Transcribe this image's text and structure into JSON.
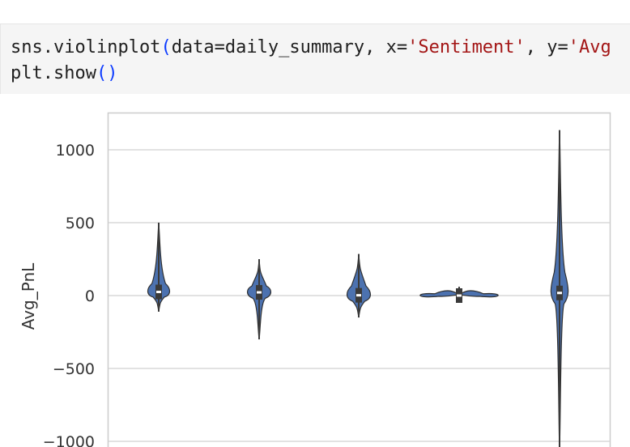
{
  "code_cell": {
    "line1": {
      "prefix": "sns.violinplot",
      "open_paren": "(",
      "args_a": "data=daily_summary, x=",
      "str_x": "'Sentiment'",
      "args_b": ", y=",
      "str_y": "'Avg"
    },
    "line2": {
      "prefix": "plt.show",
      "parens": "()"
    }
  },
  "chart_data": {
    "type": "violin",
    "ylabel": "Avg_PnL",
    "xlabel": "",
    "y_ticks": [
      "1000",
      "500",
      "0",
      "−500",
      "−1000"
    ],
    "ylim": [
      -1050,
      1250
    ],
    "grid": true,
    "violin_color": "#4c72b0",
    "series": [
      {
        "min": -110,
        "max": 500,
        "median": 25
      },
      {
        "min": -300,
        "max": 250,
        "median": 22
      },
      {
        "min": -150,
        "max": 285,
        "median": 2
      },
      {
        "min": -25,
        "max": 60,
        "median": 0
      },
      {
        "min": -1050,
        "max": 1135,
        "median": 18
      }
    ]
  }
}
